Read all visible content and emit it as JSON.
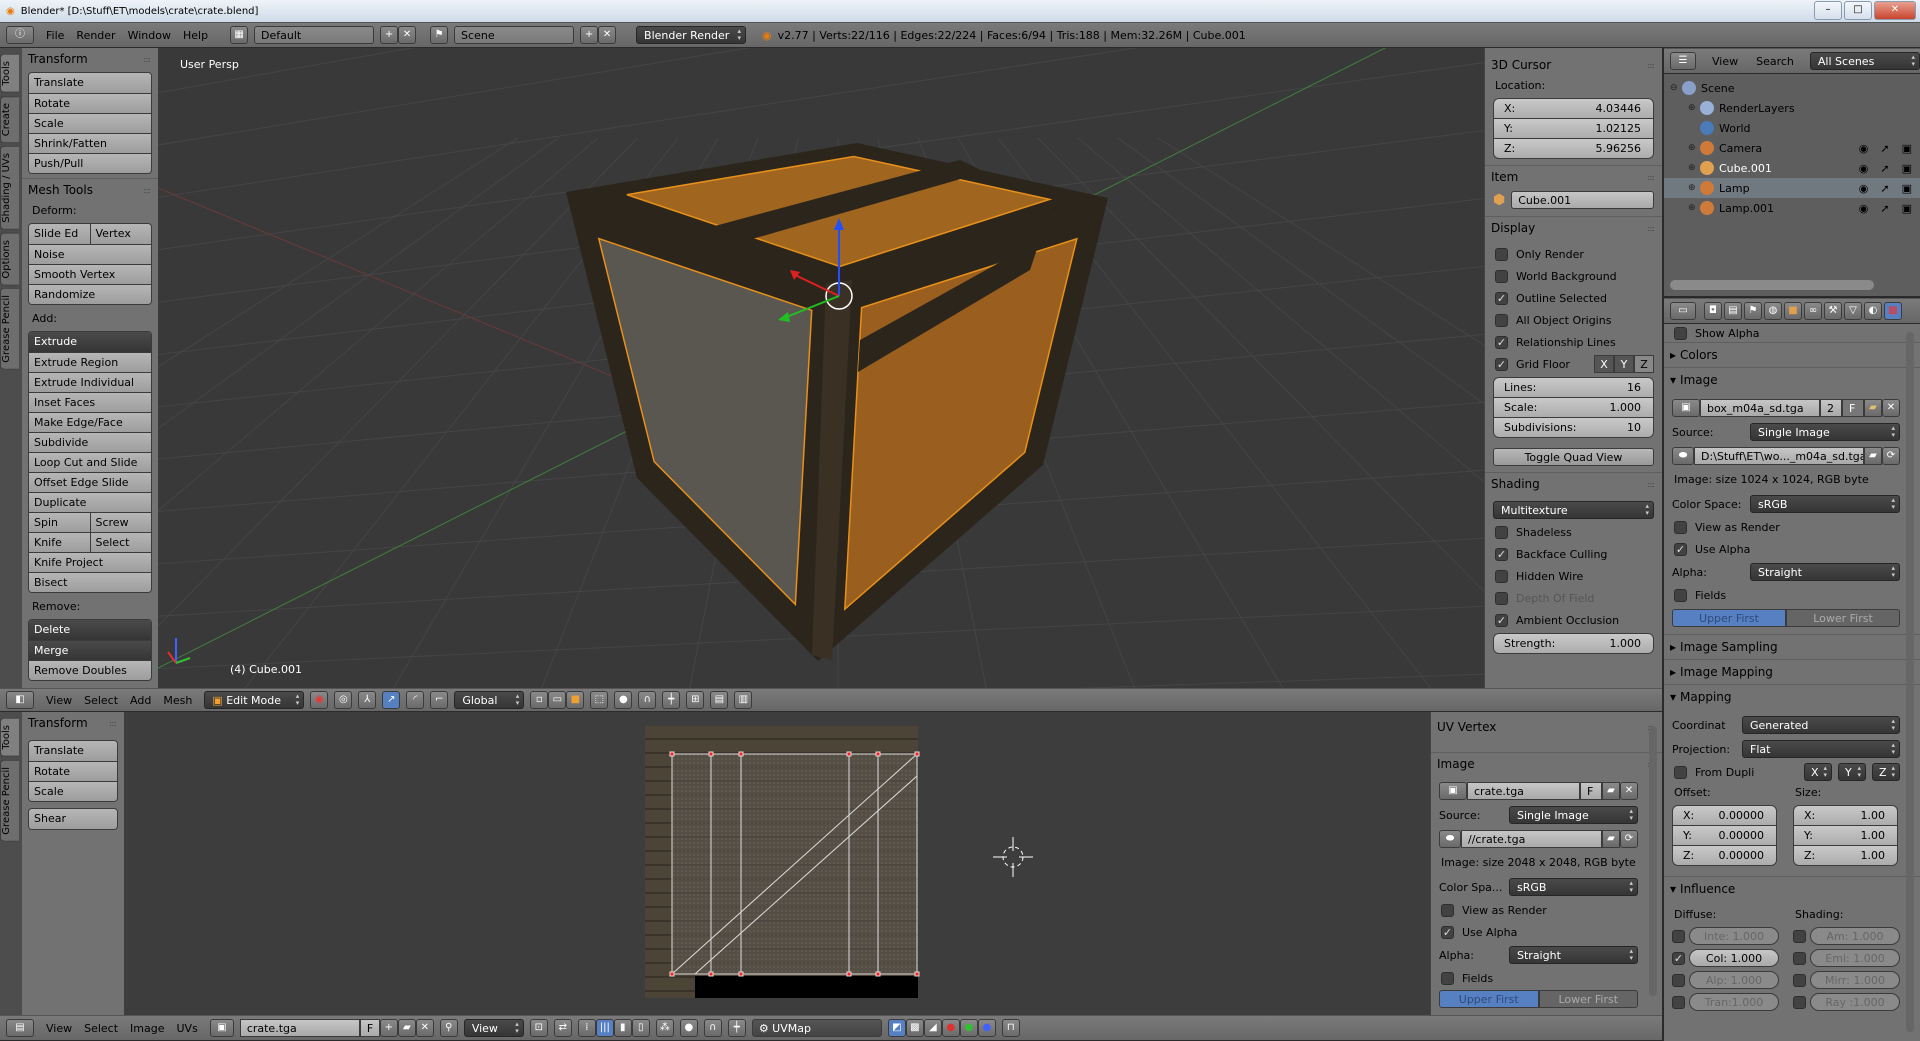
{
  "window": {
    "title": "Blender* [D:\\Stuff\\ET\\models\\crate\\crate.blend]",
    "minimize": "–",
    "maximize": "□",
    "close": "✕"
  },
  "info_header": {
    "menus": [
      "File",
      "Render",
      "Window",
      "Help"
    ],
    "layout": "Default",
    "scene": "Scene",
    "engine": "Blender Render",
    "stats": "v2.77 | Verts:22/116 | Edges:22/224 | Faces:6/94 | Tris:188 | Mem:32.26M | Cube.001"
  },
  "toolshelf_3d": {
    "tabs": [
      "Tools",
      "Create",
      "Shading / UVs",
      "Options",
      "Grease Pencil"
    ],
    "transform_title": "Transform",
    "transform": [
      [
        "Translate"
      ],
      [
        "Rotate"
      ],
      [
        "Scale"
      ],
      [
        "Shrink/Fatten"
      ],
      [
        "Push/Pull"
      ]
    ],
    "mesh_tools_title": "Mesh Tools",
    "deform_label": "Deform:",
    "deform": [
      [
        "Slide Ed",
        "Vertex"
      ],
      [
        "Noise"
      ],
      [
        "Smooth Vertex"
      ],
      [
        "Randomize"
      ]
    ],
    "add_label": "Add:",
    "add": [
      [
        "Extrude"
      ],
      [
        "Extrude Region"
      ],
      [
        "Extrude Individual"
      ],
      [
        "Inset Faces"
      ],
      [
        "Make Edge/Face"
      ],
      [
        "Subdivide"
      ],
      [
        "Loop Cut and Slide"
      ],
      [
        "Offset Edge Slide"
      ],
      [
        "Duplicate"
      ],
      [
        "Spin",
        "Screw"
      ],
      [
        "Knife",
        "Select"
      ],
      [
        "Knife Project"
      ],
      [
        "Bisect"
      ]
    ],
    "remove_label": "Remove:",
    "remove": [
      [
        "Delete"
      ],
      [
        "Merge"
      ],
      [
        "Remove Doubles"
      ]
    ]
  },
  "viewport": {
    "view_label": "User Persp",
    "object_label": "(4) Cube.001"
  },
  "n_panel_3d": {
    "cursor_title": "3D Cursor",
    "location_label": "Location:",
    "location": [
      {
        "axis": "X:",
        "value": "4.03446"
      },
      {
        "axis": "Y:",
        "value": "1.02125"
      },
      {
        "axis": "Z:",
        "value": "5.96256"
      }
    ],
    "item_title": "Item",
    "item_name": "Cube.001",
    "display_title": "Display",
    "display_checks": [
      {
        "label": "Only Render",
        "checked": false
      },
      {
        "label": "World Background",
        "checked": false
      },
      {
        "label": "Outline Selected",
        "checked": true
      },
      {
        "label": "All Object Origins",
        "checked": false
      },
      {
        "label": "Relationship Lines",
        "checked": true
      }
    ],
    "grid_floor": {
      "label": "Grid Floor",
      "checked": true,
      "axes": [
        "X",
        "Y",
        "Z"
      ]
    },
    "grid_values": [
      {
        "label": "Lines:",
        "value": "16"
      },
      {
        "label": "Scale:",
        "value": "1.000"
      },
      {
        "label": "Subdivisions:",
        "value": "10"
      }
    ],
    "toggle_quad": "Toggle Quad View",
    "shading_title": "Shading",
    "shading_mode": "Multitexture",
    "shading_checks": [
      {
        "label": "Shadeless",
        "checked": false
      },
      {
        "label": "Backface Culling",
        "checked": true
      },
      {
        "label": "Hidden Wire",
        "checked": false
      },
      {
        "label": "Depth Of Field",
        "checked": false,
        "disabled": true
      },
      {
        "label": "Ambient Occlusion",
        "checked": true
      }
    ],
    "strength": {
      "label": "Strength:",
      "value": "1.000"
    }
  },
  "header_3d": {
    "menus": [
      "View",
      "Select",
      "Add",
      "Mesh"
    ],
    "mode": "Edit Mode",
    "orientation": "Global"
  },
  "outliner": {
    "menus": [
      "View",
      "Search"
    ],
    "display_mode": "All Scenes",
    "items": [
      {
        "name": "Scene",
        "depth": 0,
        "color": "#8aa0c8"
      },
      {
        "name": "RenderLayers",
        "depth": 1,
        "color": "#9ab0d8"
      },
      {
        "name": "World",
        "depth": 1,
        "color": "#4a7ab8"
      },
      {
        "name": "Camera",
        "depth": 1,
        "color": "#d07a3a"
      },
      {
        "name": "Cube.001",
        "depth": 1,
        "color": "#e0a050",
        "active": true
      },
      {
        "name": "Lamp",
        "depth": 1,
        "color": "#d07a3a",
        "selected": true
      },
      {
        "name": "Lamp.001",
        "depth": 1,
        "color": "#d07a3a"
      }
    ]
  },
  "properties": {
    "show_alpha": "Show Alpha",
    "colors_title": "Colors",
    "image_title": "Image",
    "image_name": "box_m04a_sd.tga",
    "image_users": "2",
    "fake_user": "F",
    "source_label": "Source:",
    "source": "Single Image",
    "filepath": "D:\\Stuff\\ET\\wo..._m04a_sd.tga",
    "image_info": "Image: size 1024 x 1024, RGB byte",
    "color_space_label": "Color Space:",
    "color_space": "sRGB",
    "view_as_render": "View as Render",
    "use_alpha": "Use Alpha",
    "alpha_label": "Alpha:",
    "alpha": "Straight",
    "fields": "Fields",
    "upper_first": "Upper First",
    "lower_first": "Lower First",
    "image_sampling_title": "Image Sampling",
    "image_mapping_title": "Image Mapping",
    "mapping_title": "Mapping",
    "coordinates_label": "Coordinat",
    "coordinates": "Generated",
    "projection_label": "Projection:",
    "projection": "Flat",
    "from_dupli": "From Dupli",
    "xyz": [
      "X",
      "Y",
      "Z"
    ],
    "offset_label": "Offset:",
    "size_label": "Size:",
    "offset": [
      {
        "axis": "X:",
        "value": "0.00000"
      },
      {
        "axis": "Y:",
        "value": "0.00000"
      },
      {
        "axis": "Z:",
        "value": "0.00000"
      }
    ],
    "size": [
      {
        "axis": "X:",
        "value": "1.00"
      },
      {
        "axis": "Y:",
        "value": "1.00"
      },
      {
        "axis": "Z:",
        "value": "1.00"
      }
    ],
    "influence_title": "Influence",
    "diffuse_label": "Diffuse:",
    "shading_label": "Shading:",
    "diffuse": [
      {
        "label": "Inte: 1.000",
        "checked": false
      },
      {
        "label": "Col: 1.000",
        "checked": true
      },
      {
        "label": "Alp: 1.000",
        "checked": false
      },
      {
        "label": "Tran:1.000",
        "checked": false
      }
    ],
    "shading": [
      {
        "label": "Am: 1.000",
        "checked": false
      },
      {
        "label": "Emi: 1.000",
        "checked": false
      },
      {
        "label": "Mirr: 1.000",
        "checked": false
      },
      {
        "label": "Ray :1.000",
        "checked": false
      }
    ]
  },
  "toolshelf_uv": {
    "tabs": [
      "Tools",
      "Grease Pencil"
    ],
    "transform_title": "Transform",
    "transform": [
      [
        "Translate"
      ],
      [
        "Rotate"
      ],
      [
        "Scale"
      ]
    ],
    "shear": [
      [
        "Shear"
      ]
    ]
  },
  "n_panel_uv": {
    "uv_vertex_title": "UV Vertex",
    "image_title": "Image",
    "image_name": "crate.tga",
    "fake_user": "F",
    "source_label": "Source:",
    "source": "Single Image",
    "filepath": "//crate.tga",
    "image_info": "Image: size 2048 x 2048, RGB byte",
    "color_space_label": "Color Spa...",
    "color_space": "sRGB",
    "view_as_render": "View as Render",
    "use_alpha": "Use Alpha",
    "alpha_label": "Alpha:",
    "alpha": "Straight",
    "fields": "Fields",
    "upper_first": "Upper First",
    "lower_first": "Lower First"
  },
  "footer_uv": {
    "menus": [
      "View",
      "Select",
      "Image",
      "UVs"
    ],
    "image": "crate.tga",
    "fake_user": "F",
    "view_mode": "View",
    "uv_map": "UVMap"
  },
  "colors": {
    "accent_blue": "#5680c2",
    "selection_orange": "#f0a030",
    "uv_vertex_red": "#ff2020"
  }
}
